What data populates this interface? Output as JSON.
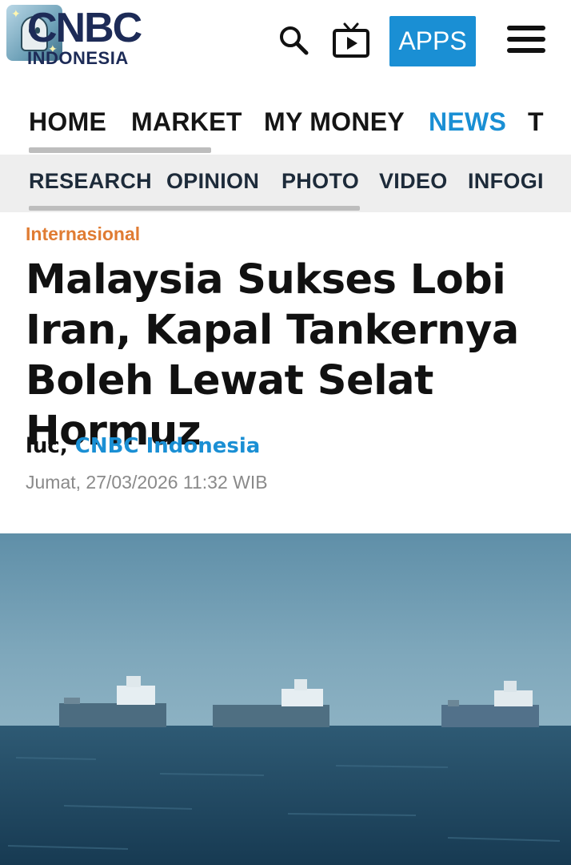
{
  "header": {
    "logo_main": "CNBC",
    "logo_sub": "INDONESIA",
    "apps_label": "APPS"
  },
  "nav_main": {
    "items": [
      "HOME",
      "MARKET",
      "MY MONEY",
      "NEWS",
      "T"
    ],
    "active_index": 3
  },
  "nav_sub": {
    "items": [
      "RESEARCH",
      "OPINION",
      "PHOTO",
      "VIDEO",
      "INFOGI"
    ]
  },
  "article": {
    "category": "Internasional",
    "headline": "Malaysia Sukses Lobi Iran, Kapal Tankernya Boleh Lewat Selat Hormuz",
    "author": "luc,",
    "source": "CNBC Indonesia",
    "date": "Jumat, 27/03/2026 11:32 WIB"
  },
  "colors": {
    "accent_blue": "#1a8fd4",
    "category_orange": "#e07c33",
    "brand_navy": "#1d2b57"
  },
  "icons": [
    "search-icon",
    "tv-play-icon",
    "hamburger-menu-icon"
  ]
}
